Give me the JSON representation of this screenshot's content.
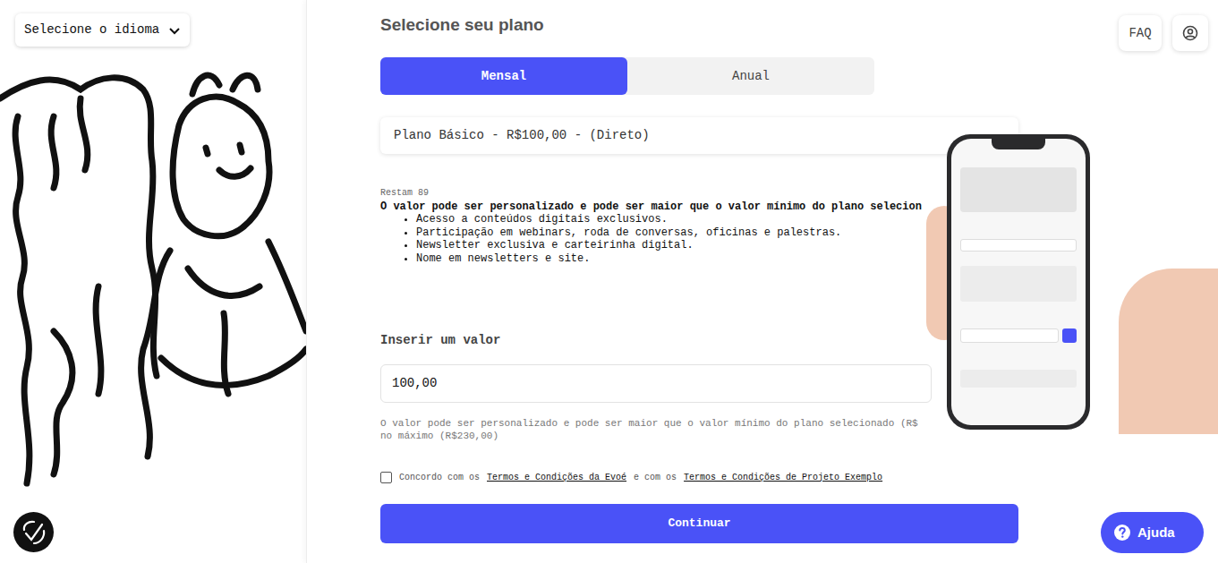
{
  "language_select": {
    "label": "Selecione o idioma"
  },
  "header": {
    "faq": "FAQ"
  },
  "title": "Selecione seu plano",
  "tabs": [
    {
      "label": "Mensal",
      "selected": true
    },
    {
      "label": "Anual",
      "selected": false
    }
  ],
  "plan_select": {
    "value": "Plano Básico - R$100,00 - (Direto)"
  },
  "remaining": "Restam 89",
  "description": "O valor pode ser personalizado e pode ser maior que o valor mínimo do plano selecion",
  "benefits": [
    "Acesso a conteúdos digitais exclusivos.",
    "Participação em webinars, roda de conversas, oficinas e palestras.",
    "Newsletter exclusiva e carteirinha digital.",
    "Nome em newsletters e site."
  ],
  "amount": {
    "label": "Inserir um valor",
    "value": "100,00",
    "helper": [
      "O valor pode ser personalizado e pode ser maior que o valor mínimo do plano selecionado (R$",
      "no máximo (R$230,00)"
    ]
  },
  "terms": {
    "checked": false,
    "prefix": "Concordo com os",
    "link1": "Termos e Condições da Evoé",
    "middle": "e com os",
    "link2": "Termos e Condições de Projeto Exemplo"
  },
  "continue_button": "Continuar",
  "help_button": "Ajuda"
}
